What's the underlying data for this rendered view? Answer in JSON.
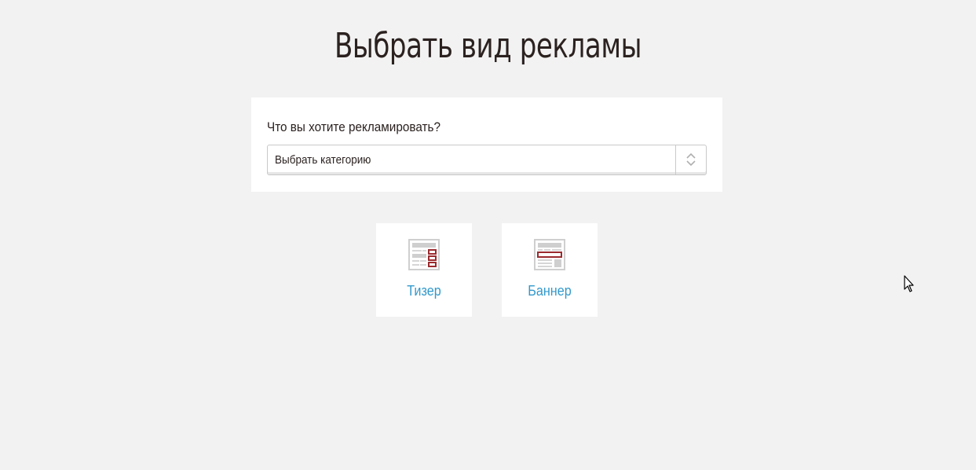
{
  "header": {
    "title": "Выбрать вид рекламы"
  },
  "form": {
    "label": "Что вы хотите рекламировать?",
    "select": {
      "selected": "Выбрать категорию",
      "arrow_icon": "updown-chevron-icon"
    }
  },
  "ad_types": [
    {
      "label": "Тизер",
      "icon": "teaser-layout-icon"
    },
    {
      "label": "Баннер",
      "icon": "banner-layout-icon"
    }
  ],
  "colors": {
    "background": "#f2f2f2",
    "card": "#ffffff",
    "link": "#3399cc",
    "accent": "#9b2b2f",
    "text": "#2b2220"
  }
}
